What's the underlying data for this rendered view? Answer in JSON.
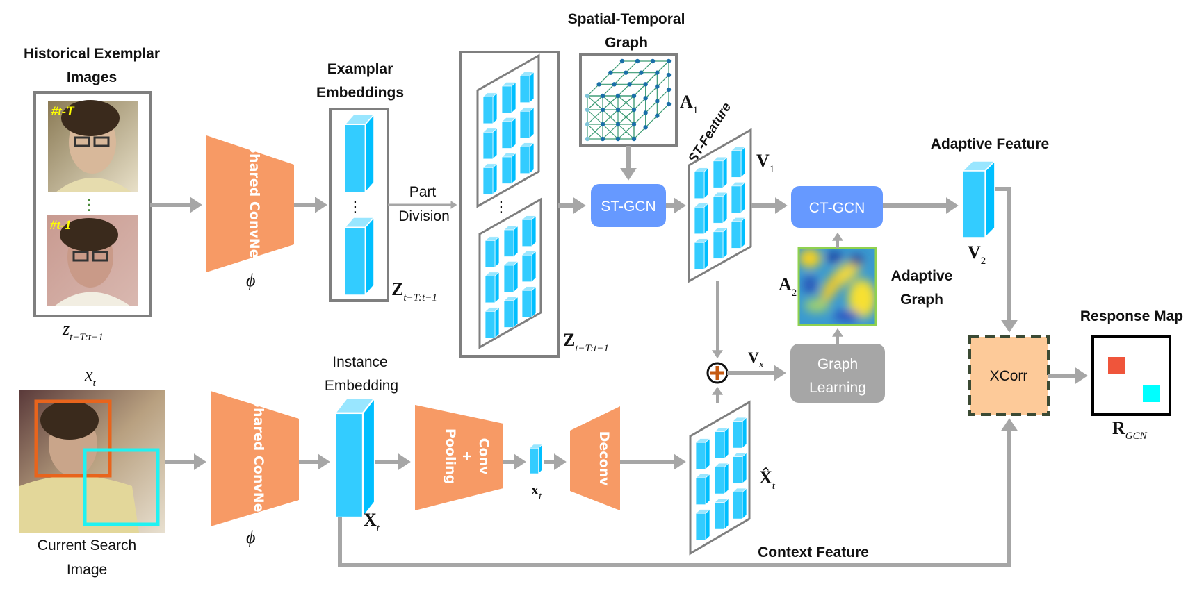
{
  "titles": {
    "historical_1": "Historical Exemplar",
    "historical_2": "Images",
    "examplar_1": "Examplar",
    "examplar_2": "Embeddings",
    "part_1": "Part",
    "part_2": "Division",
    "st_graph_1": "Spatial-Temporal",
    "st_graph_2": "Graph",
    "st_feature": "ST-Feature",
    "adaptive_feature": "Adaptive Feature",
    "adaptive_graph_1": "Adaptive",
    "adaptive_graph_2": "Graph",
    "response_map": "Response Map",
    "instance_1": "Instance",
    "instance_2": "Embedding",
    "context_feature": "Context  Feature",
    "current_1": "Current Search",
    "current_2": "Image"
  },
  "frame_tags": {
    "first": "#t-T",
    "last": "#t-1"
  },
  "blocks": {
    "shared_convnet": "Shared ConvNet",
    "conv": "Conv",
    "plus": "+",
    "pooling": "Pooling",
    "deconv": "Deconv",
    "st_gcn": "ST-GCN",
    "ct_gcn": "CT-GCN",
    "graph_learning_1": "Graph",
    "graph_learning_2": "Learning",
    "xcorr": "XCorr",
    "ellipsis": "⋮"
  },
  "math": {
    "z_small": {
      "main": "z",
      "sub": "t−T:t−1"
    },
    "z_embed": {
      "main": "Z",
      "sub": "t−T:t−1"
    },
    "z_parts": {
      "main": "Z",
      "sub": "t−T:t−1"
    },
    "phi": "ϕ",
    "a1": {
      "main": "A",
      "sub": "1"
    },
    "a2": {
      "main": "A",
      "sub": "2"
    },
    "v1": {
      "main": "V",
      "sub": "1"
    },
    "v2": {
      "main": "V",
      "sub": "2"
    },
    "vx": {
      "main": "V",
      "sub": "x"
    },
    "x_small": {
      "main": "x",
      "sub": "t"
    },
    "X_inst": {
      "main": "X",
      "sub": "t"
    },
    "x_pooled": {
      "main": "x",
      "sub": "t"
    },
    "X_hat": {
      "main": "X̂",
      "sub": "t"
    },
    "r_gcn": {
      "main": "R",
      "sub": "GCN"
    }
  },
  "colors": {
    "block_orange": "#f79a65",
    "gcn_blue": "#6699ff",
    "graph_learning_gray": "#a6a6a6",
    "xcorr_fill": "#fdca99",
    "xcorr_border": "#3b4a34",
    "cuboid_front": "#33ccff",
    "cuboid_side": "#00bfff",
    "cuboid_top": "#99e6ff",
    "target_box": "#e8641c",
    "search_box": "#1ff2f2",
    "response_peak_red": "#ef553b",
    "response_peak_cyan": "#00ffff",
    "graph_edge": "#3a9a72",
    "graph_node": "#1a6fa8"
  }
}
